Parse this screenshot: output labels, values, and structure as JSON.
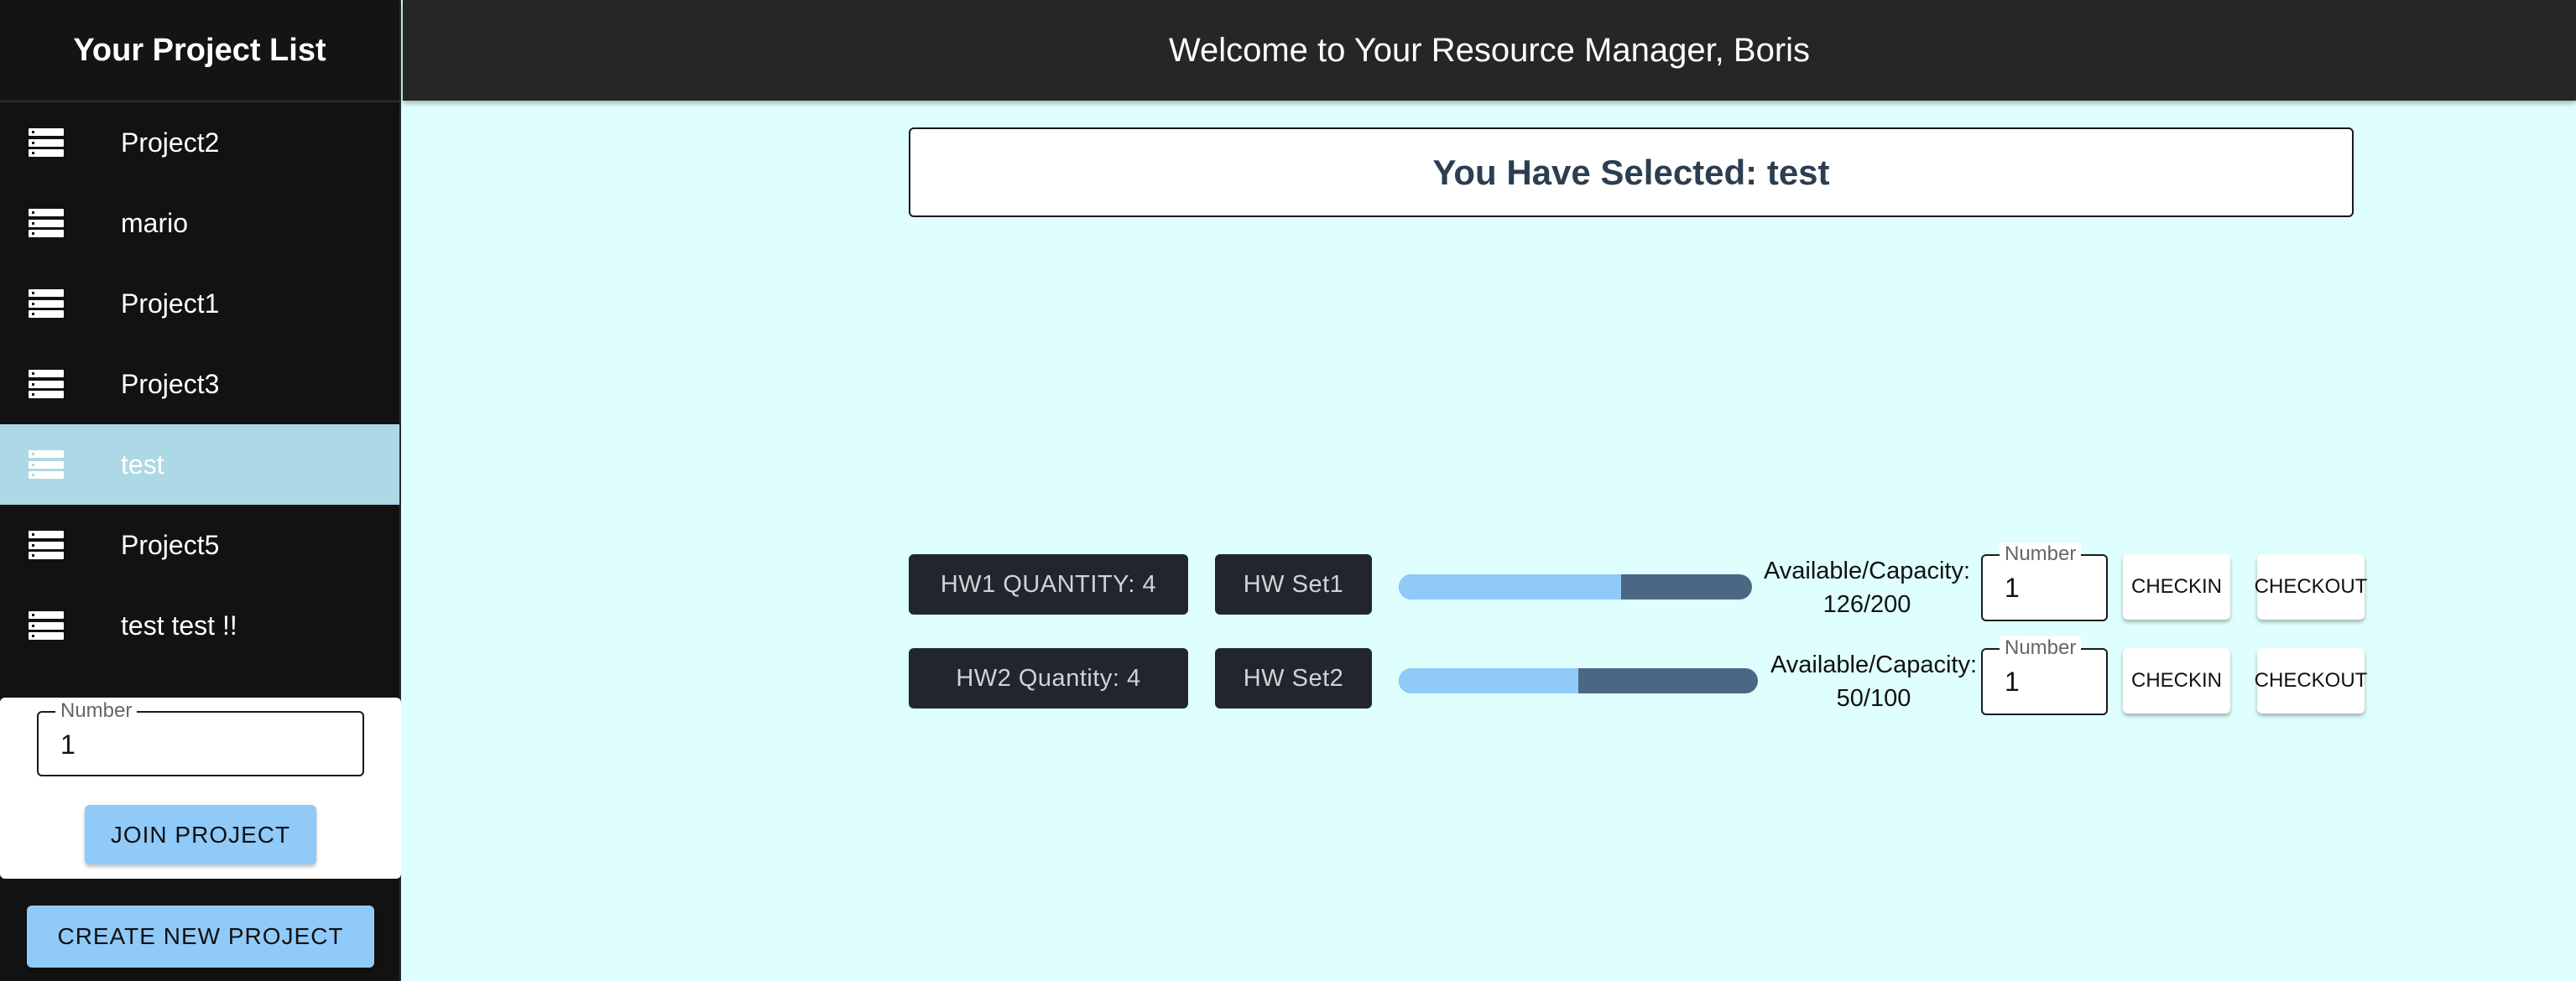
{
  "sidebar": {
    "title": "Your Project List",
    "items": [
      {
        "label": "Project2",
        "icon": "server-list-icon"
      },
      {
        "label": "mario",
        "icon": "server-list-icon"
      },
      {
        "label": "Project1",
        "icon": "server-list-icon"
      },
      {
        "label": "Project3",
        "icon": "server-list-icon"
      },
      {
        "label": "test",
        "icon": "server-list-icon",
        "selected": true
      },
      {
        "label": "Project5",
        "icon": "server-list-icon"
      },
      {
        "label": "test test !!",
        "icon": "server-list-icon"
      }
    ],
    "join": {
      "field_label": "Number",
      "field_value": "1",
      "button_label": "JOIN PROJECT"
    },
    "create_button_label": "CREATE NEW PROJECT"
  },
  "header": {
    "title": "Welcome to Your Resource Manager, Boris"
  },
  "main": {
    "selected_text": "You Have Selected: test",
    "hardware": [
      {
        "quantity_label": "HW1 QUANTITY: 4",
        "set_label": "HW Set1",
        "availability_label": "Available/Capacity:",
        "availability_value": "126/200",
        "available_fraction": 0.63,
        "field_label": "Number",
        "field_value": "1",
        "checkin_label": "CHECKIN",
        "checkout_label": "CHECKOUT"
      },
      {
        "quantity_label": "HW2 Quantity: 4",
        "set_label": "HW Set2",
        "availability_label": "Available/Capacity:",
        "availability_value": "50/100",
        "available_fraction": 0.5,
        "field_label": "Number",
        "field_value": "1",
        "checkin_label": "CHECKIN",
        "checkout_label": "CHECKOUT"
      }
    ]
  },
  "colors": {
    "sidebar_bg": "#121212",
    "selected_item_bg": "#add8e6",
    "main_bg": "#dffffe",
    "accent_button": "#90caf9",
    "progress_track": "#4a6784"
  }
}
